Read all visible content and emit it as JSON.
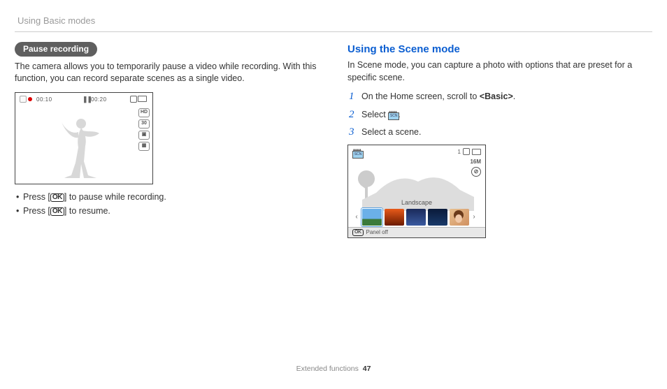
{
  "header": {
    "breadcrumb": "Using Basic modes"
  },
  "left": {
    "pill": "Pause recording",
    "para": "The camera allows you to temporarily pause a video while recording. With this function, you can record separate scenes as a single video.",
    "screenshot": {
      "time1": "00:10",
      "time2": "00:20",
      "side_labels": [
        "HD",
        "30",
        "",
        ""
      ]
    },
    "bullet1_a": "Press [",
    "bullet1_ok": "OK",
    "bullet1_b": "] to pause while recording.",
    "bullet2_a": "Press [",
    "bullet2_ok": "OK",
    "bullet2_b": "] to resume."
  },
  "right": {
    "heading": "Using the Scene mode",
    "para": "In Scene mode, you can capture a photo with options that are preset for a specific scene.",
    "step1_a": "On the Home screen, scroll to ",
    "step1_b": "<Basic>",
    "step1_c": ".",
    "step2_a": "Select ",
    "step2_b": ".",
    "step3": "Select a scene.",
    "screenshot": {
      "counter": "1",
      "res": "16M",
      "landscape": "Landscape",
      "panel_ok": "OK",
      "panel_text": "Panel off"
    }
  },
  "footer": {
    "section": "Extended functions",
    "page": "47"
  }
}
